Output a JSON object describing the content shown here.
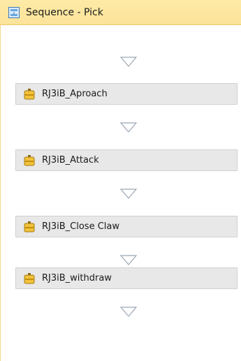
{
  "sequence": {
    "title": "Sequence - Pick",
    "icon": "sequence-icon",
    "header_color": "#fce39a",
    "activities": [
      {
        "label": "RJ3iB_Aproach",
        "icon": "activity-icon"
      },
      {
        "label": "RJ3iB_Attack",
        "icon": "activity-icon"
      },
      {
        "label": "RJ3iB_Close Claw",
        "icon": "activity-icon"
      },
      {
        "label": "RJ3iB_withdraw",
        "icon": "activity-icon"
      }
    ],
    "drop_target_icon": "drop-arrow-icon"
  }
}
